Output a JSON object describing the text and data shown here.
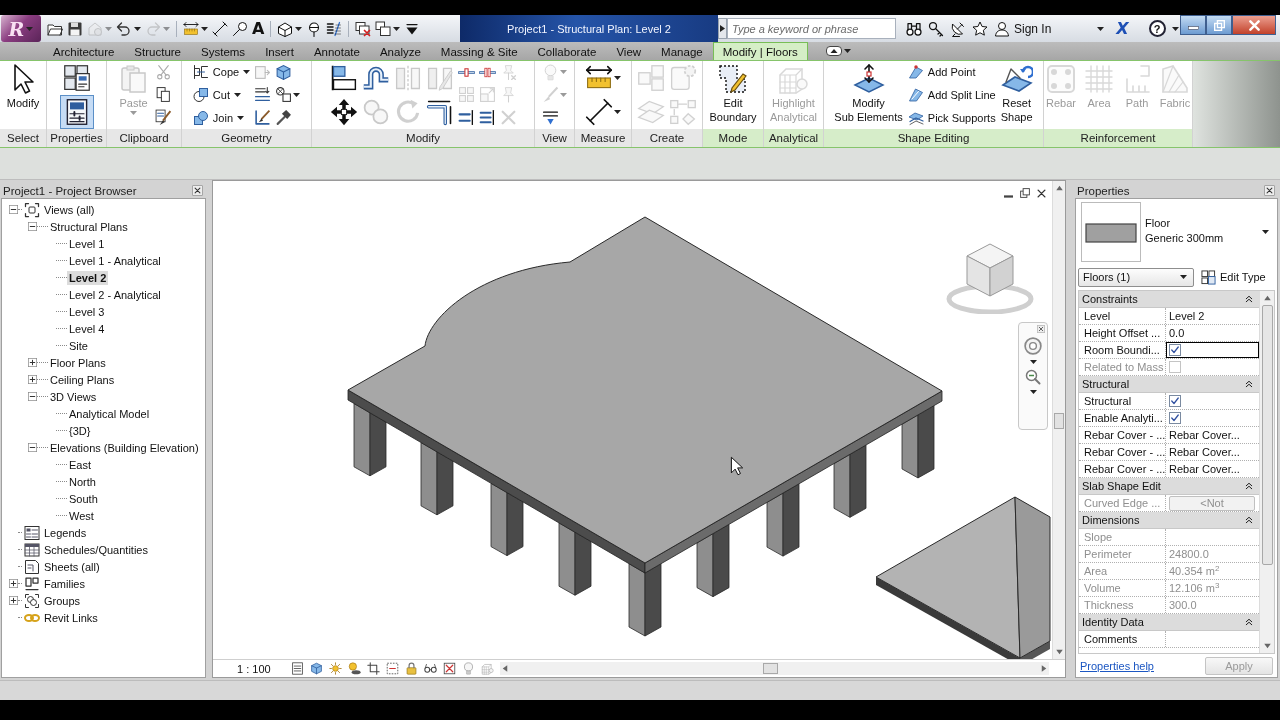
{
  "title_bar": {
    "app_button": "R",
    "quick_access": [
      {
        "kind": "icon",
        "disabled": false
      },
      {
        "kind": "icon",
        "disabled": false
      },
      {
        "kind": "icon",
        "disabled": true
      },
      {
        "kind": "icon",
        "disabled": false
      },
      {
        "kind": "icon",
        "disabled": true
      },
      {
        "kind": "icon",
        "disabled": false
      },
      {
        "kind": "icon",
        "disabled": false
      },
      {
        "kind": "icon",
        "disabled": false
      },
      {
        "kind": "glyph",
        "glyph": "A",
        "disabled": false
      },
      {
        "kind": "icon",
        "disabled": false
      },
      {
        "kind": "icon",
        "disabled": false
      },
      {
        "kind": "icon",
        "disabled": false
      },
      {
        "kind": "icon",
        "disabled": false
      },
      {
        "kind": "icon",
        "disabled": false
      },
      {
        "kind": "icon",
        "disabled": false
      }
    ],
    "title": "Project1 - Structural Plan: Level 2",
    "search": {
      "placeholder": "Type a keyword or phrase"
    },
    "sign_in": "Sign In",
    "logo_button": "X",
    "help_button": "?"
  },
  "ribbon_tabs": [
    {
      "label": "Architecture",
      "selected": false
    },
    {
      "label": "Structure",
      "selected": false
    },
    {
      "label": "Systems",
      "selected": false
    },
    {
      "label": "Insert",
      "selected": false
    },
    {
      "label": "Annotate",
      "selected": false
    },
    {
      "label": "Analyze",
      "selected": false
    },
    {
      "label": "Massing & Site",
      "selected": false
    },
    {
      "label": "Collaborate",
      "selected": false
    },
    {
      "label": "View",
      "selected": false
    },
    {
      "label": "Manage",
      "selected": false
    },
    {
      "label": "Modify | Floors",
      "selected": true
    }
  ],
  "ribbon_panels": [
    {
      "label": "Select",
      "contextual": false,
      "tools": [
        {
          "kind": "large",
          "label": "Modify",
          "disabled": false
        }
      ]
    },
    {
      "label": "Properties",
      "contextual": false,
      "tools": [
        {
          "kind": "medium",
          "on": false,
          "disabled": false
        },
        {
          "kind": "medium",
          "on": true,
          "disabled": false
        }
      ]
    },
    {
      "label": "Clipboard",
      "contextual": false,
      "tools": [
        {
          "kind": "large",
          "label": "Paste",
          "disabled": true
        },
        {
          "kind": "icon",
          "disabled": true
        },
        {
          "kind": "icon",
          "disabled": false
        },
        {
          "kind": "icon",
          "disabled": false
        }
      ]
    },
    {
      "label": "Geometry",
      "contextual": false,
      "tools": [
        {
          "kind": "small",
          "label": "Cope",
          "disabled": false
        },
        {
          "kind": "small",
          "label": "Cut",
          "disabled": false
        },
        {
          "kind": "small",
          "label": "Join",
          "disabled": false
        },
        {
          "kind": "icon",
          "disabled": true
        },
        {
          "kind": "icon",
          "disabled": false
        },
        {
          "kind": "icon",
          "disabled": false
        },
        {
          "kind": "icon",
          "disabled": false
        },
        {
          "kind": "icon",
          "disabled": false
        },
        {
          "kind": "icon",
          "disabled": false
        }
      ]
    },
    {
      "label": "Modify",
      "contextual": false,
      "tools": [
        {
          "kind": "medium",
          "disabled": false
        },
        {
          "kind": "medium",
          "disabled": false
        },
        {
          "kind": "medium",
          "disabled": false
        },
        {
          "kind": "medium",
          "disabled": true
        },
        {
          "kind": "medium",
          "disabled": true
        },
        {
          "kind": "medium",
          "disabled": true
        },
        {
          "kind": "medium",
          "disabled": true
        },
        {
          "kind": "medium",
          "disabled": false
        },
        {
          "kind": "icon",
          "disabled": false
        },
        {
          "kind": "icon",
          "disabled": true
        },
        {
          "kind": "icon",
          "disabled": false
        },
        {
          "kind": "icon",
          "disabled": false
        },
        {
          "kind": "icon",
          "disabled": true
        },
        {
          "kind": "icon",
          "disabled": false
        },
        {
          "kind": "icon",
          "disabled": true
        },
        {
          "kind": "icon",
          "disabled": true
        },
        {
          "kind": "icon",
          "disabled": true
        }
      ]
    },
    {
      "label": "View",
      "contextual": false,
      "tools": [
        {
          "kind": "icon",
          "disabled": true
        },
        {
          "kind": "icon",
          "disabled": true
        },
        {
          "kind": "icon",
          "disabled": false
        }
      ]
    },
    {
      "label": "Measure",
      "contextual": false,
      "tools": [
        {
          "kind": "medium",
          "disabled": false
        },
        {
          "kind": "medium",
          "disabled": false
        }
      ]
    },
    {
      "label": "Create",
      "contextual": false,
      "tools": [
        {
          "kind": "medium",
          "disabled": true
        },
        {
          "kind": "medium",
          "disabled": true
        },
        {
          "kind": "medium",
          "disabled": true
        },
        {
          "kind": "medium",
          "disabled": true
        }
      ]
    },
    {
      "label": "Mode",
      "contextual": true,
      "tools": [
        {
          "kind": "large",
          "label": "Edit\nBoundary",
          "disabled": false
        }
      ]
    },
    {
      "label": "Analytical",
      "contextual": true,
      "tools": [
        {
          "kind": "large",
          "label": "Highlight\nAnalytical",
          "disabled": true
        }
      ]
    },
    {
      "label": "Shape Editing",
      "contextual": true,
      "tools": [
        {
          "kind": "large",
          "label": "Modify\nSub Elements",
          "disabled": false
        },
        {
          "kind": "small",
          "label": "Add Point",
          "disabled": false
        },
        {
          "kind": "small",
          "label": "Add Split Line",
          "disabled": false
        },
        {
          "kind": "small",
          "label": "Pick Supports",
          "disabled": false
        },
        {
          "kind": "large",
          "label": "Reset\nShape",
          "disabled": false
        }
      ]
    },
    {
      "label": "Reinforcement",
      "contextual": true,
      "tools": [
        {
          "kind": "large",
          "label": "Rebar",
          "disabled": true
        },
        {
          "kind": "large",
          "label": "Area",
          "disabled": true
        },
        {
          "kind": "large",
          "label": "Path",
          "disabled": true
        },
        {
          "kind": "large",
          "label": "Fabric",
          "disabled": true
        }
      ]
    }
  ],
  "project_browser": {
    "title": "Project1 - Project Browser",
    "items": [
      {
        "label": "Views (all)",
        "expanded": true,
        "selected": false,
        "children": [
          {
            "label": "Structural Plans",
            "expanded": true,
            "selected": false,
            "children": [
              {
                "label": "Level 1",
                "selected": false
              },
              {
                "label": "Level 1 - Analytical",
                "selected": false
              },
              {
                "label": "Level 2",
                "selected": true
              },
              {
                "label": "Level 2 - Analytical",
                "selected": false
              },
              {
                "label": "Level 3",
                "selected": false
              },
              {
                "label": "Level 4",
                "selected": false
              },
              {
                "label": "Site",
                "selected": false
              }
            ]
          },
          {
            "label": "Floor Plans",
            "expanded": false,
            "selected": false
          },
          {
            "label": "Ceiling Plans",
            "expanded": false,
            "selected": false
          },
          {
            "label": "3D Views",
            "expanded": true,
            "selected": false,
            "children": [
              {
                "label": "Analytical Model",
                "selected": false
              },
              {
                "label": "{3D}",
                "selected": false
              }
            ]
          },
          {
            "label": "Elevations (Building Elevation)",
            "expanded": true,
            "selected": false,
            "children": [
              {
                "label": "East",
                "selected": false
              },
              {
                "label": "North",
                "selected": false
              },
              {
                "label": "South",
                "selected": false
              },
              {
                "label": "West",
                "selected": false
              }
            ]
          }
        ]
      },
      {
        "label": "Legends",
        "selected": false
      },
      {
        "label": "Schedules/Quantities",
        "selected": false
      },
      {
        "label": "Sheets (all)",
        "selected": false
      },
      {
        "label": "Families",
        "expanded": false,
        "selected": false
      },
      {
        "label": "Groups",
        "expanded": false,
        "selected": false
      },
      {
        "label": "Revit Links",
        "selected": false
      }
    ]
  },
  "view": {
    "scale": "1 : 100"
  },
  "properties": {
    "title": "Properties",
    "type_selector": {
      "family": "Floor",
      "type": "Generic 300mm"
    },
    "instance_filter": "Floors (1)",
    "edit_type": "Edit Type",
    "groups": [
      {
        "label": "Constraints",
        "expanded": true,
        "rows": [
          {
            "name": "Level",
            "kind": "text",
            "value": "Level 2",
            "disabled": false,
            "selected": false
          },
          {
            "name": "Height Offset ...",
            "kind": "text",
            "value": "0.0",
            "disabled": false,
            "selected": false
          },
          {
            "name": "Room Boundi...",
            "kind": "checkbox",
            "checked": true,
            "disabled": false,
            "selected": true
          },
          {
            "name": "Related to Mass",
            "kind": "checkbox",
            "checked": false,
            "disabled": true,
            "selected": false
          }
        ]
      },
      {
        "label": "Structural",
        "expanded": true,
        "rows": [
          {
            "name": "Structural",
            "kind": "checkbox",
            "checked": true,
            "disabled": false,
            "selected": false
          },
          {
            "name": "Enable Analyti...",
            "kind": "checkbox",
            "checked": true,
            "disabled": false,
            "selected": false
          },
          {
            "name": "Rebar Cover - ...",
            "kind": "text",
            "value": "Rebar Cover...",
            "disabled": false,
            "selected": false
          },
          {
            "name": "Rebar Cover - ...",
            "kind": "text",
            "value": "Rebar Cover...",
            "disabled": false,
            "selected": false
          },
          {
            "name": "Rebar Cover - ...",
            "kind": "text",
            "value": "Rebar Cover...",
            "disabled": false,
            "selected": false
          }
        ]
      },
      {
        "label": "Slab Shape Edit",
        "expanded": true,
        "rows": [
          {
            "name": "Curved Edge ...",
            "kind": "button",
            "value": "<Not",
            "disabled": true,
            "selected": false
          }
        ]
      },
      {
        "label": "Dimensions",
        "expanded": true,
        "rows": [
          {
            "name": "Slope",
            "kind": "text",
            "disabled": true,
            "selected": false
          },
          {
            "name": "Perimeter",
            "kind": "text",
            "value": "24800.0",
            "disabled": true,
            "selected": false
          },
          {
            "name": "Area",
            "kind": "text",
            "value": "40.354 m$^{2}$",
            "disabled": true,
            "selected": false
          },
          {
            "name": "Volume",
            "kind": "text",
            "value": "12.106 m$^{3}$",
            "disabled": true,
            "selected": false
          },
          {
            "name": "Thickness",
            "kind": "text",
            "value": "300.0",
            "disabled": true,
            "selected": false
          }
        ]
      },
      {
        "label": "Identity Data",
        "expanded": true,
        "rows": [
          {
            "name": "Comments",
            "kind": "text",
            "disabled": false,
            "selected": false
          }
        ]
      }
    ],
    "help_link": "Properties help",
    "apply": {
      "label": "Apply",
      "disabled": true
    }
  }
}
